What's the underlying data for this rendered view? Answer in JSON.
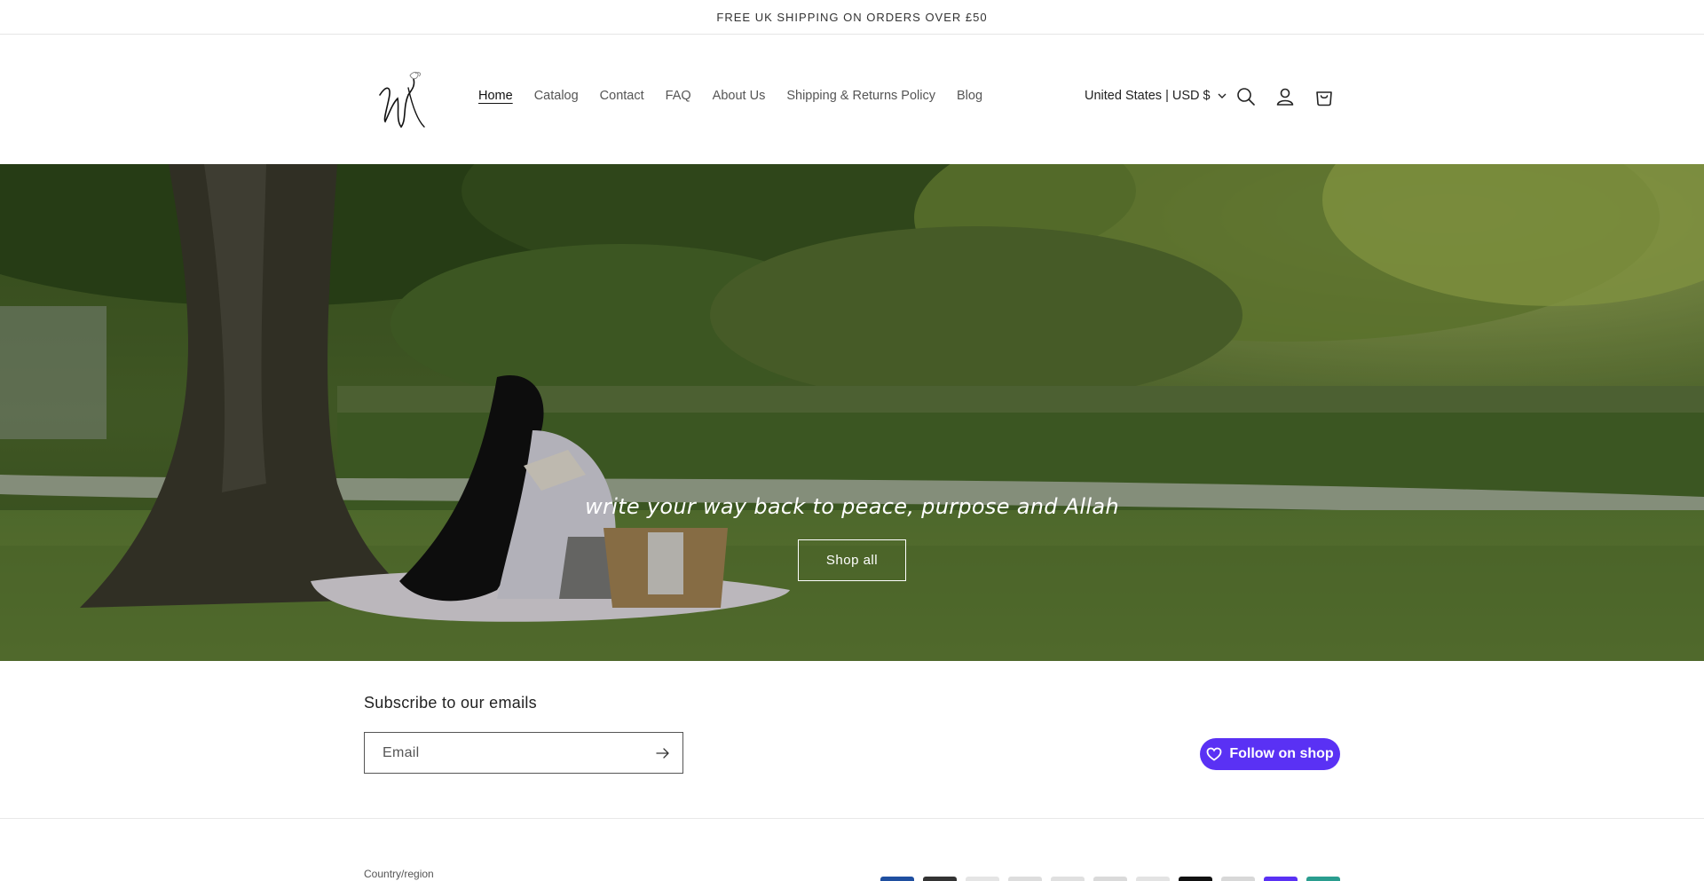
{
  "announcement": "FREE UK SHIPPING ON ORDERS OVER £50",
  "nav": {
    "items": [
      {
        "label": "Home",
        "active": true
      },
      {
        "label": "Catalog"
      },
      {
        "label": "Contact"
      },
      {
        "label": "FAQ"
      },
      {
        "label": "About Us"
      },
      {
        "label": "Shipping & Returns Policy"
      },
      {
        "label": "Blog"
      }
    ]
  },
  "header": {
    "locale": "United States | USD $",
    "icons": [
      "search-icon",
      "account-icon",
      "cart-icon"
    ]
  },
  "hero": {
    "heading": "write your way back to peace, purpose and Allah",
    "button": "Shop all"
  },
  "newsletter": {
    "title": "Subscribe to our emails",
    "placeholder": "Email"
  },
  "shop_follow": {
    "label": "Follow on shop",
    "color": "#5a31f4"
  },
  "footer": {
    "country_label": "Country/region"
  },
  "colors": {
    "payment_swatches": [
      "#1f4fa0",
      "#333333",
      "#e5e5e5",
      "#dddddd",
      "#e0e0e0",
      "#dadada",
      "#e3e3e3",
      "#111111",
      "#d8d8d8",
      "#5a31f4",
      "#2a9d8f"
    ]
  }
}
